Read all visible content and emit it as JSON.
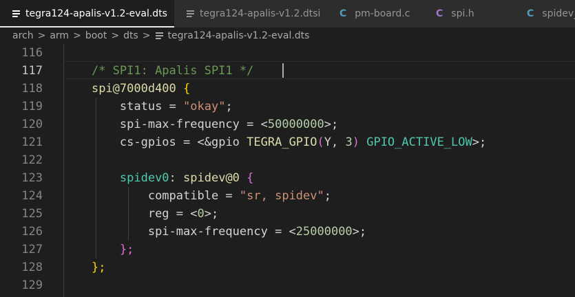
{
  "tabs": [
    {
      "label": "tegra124-apalis-v1.2-eval.dts",
      "icon": "file-lines-icon",
      "active": true
    },
    {
      "label": "tegra124-apalis-v1.2.dtsi",
      "icon": "file-lines-icon",
      "active": false
    },
    {
      "label": "pm-board.c",
      "icon": "c-file-icon",
      "icon_text": "C",
      "active": false
    },
    {
      "label": "spi.h",
      "icon": "header-file-icon",
      "icon_text": "C",
      "active": false
    },
    {
      "label": "spidev_",
      "icon": "c-file-icon",
      "icon_text": "C",
      "active": false
    }
  ],
  "tab_close_glyph": "×",
  "breadcrumb": {
    "items": [
      "arch",
      "arm",
      "boot",
      "dts"
    ],
    "separator": ">",
    "file": "tegra124-apalis-v1.2-eval.dts"
  },
  "editor": {
    "active_line": 117,
    "line_numbers": [
      "116",
      "117",
      "118",
      "119",
      "120",
      "121",
      "122",
      "123",
      "124",
      "125",
      "126",
      "127",
      "128",
      "129"
    ],
    "code": {
      "l117": "/* SPI1: Apalis SPI1 */",
      "l118_node": "spi@7000d400",
      "l118_brace": "{",
      "l119_prop": "status",
      "l119_eq": " = ",
      "l119_val": "\"okay\"",
      "l119_end": ";",
      "l120_prop": "spi-max-frequency",
      "l120_eq": " = <",
      "l120_val": "50000000",
      "l120_end": ">;",
      "l121_prop": "cs-gpios",
      "l121_eq": " = <",
      "l121_ref": "&gpio",
      "l121_sp": " TEGRA_GPIO",
      "l121_po": "(",
      "l121_args1": "Y, ",
      "l121_num": "3",
      "l121_pc": ")",
      "l121_flag": " GPIO_ACTIVE_LOW",
      "l121_end": ">;",
      "l123_label": "spidev0",
      "l123_colon": ": ",
      "l123_node": "spidev@0",
      "l123_brace": " {",
      "l124_prop": "compatible",
      "l124_eq": " = ",
      "l124_val": "\"sr, spidev\"",
      "l124_end": ";",
      "l125_prop": "reg",
      "l125_eq": " = <",
      "l125_val": "0",
      "l125_end": ">;",
      "l126_prop": "spi-max-frequency",
      "l126_eq": " = <",
      "l126_val": "25000000",
      "l126_end": ">;",
      "l127": "};",
      "l128": "};"
    }
  },
  "colors": {
    "background": "#1e1e1e",
    "comment": "#6a9955",
    "string": "#ce9178",
    "number": "#b5cea8",
    "node": "#dcdcaa",
    "label": "#4ec9b0",
    "c_icon": "#519aba",
    "h_icon": "#a074c4"
  }
}
